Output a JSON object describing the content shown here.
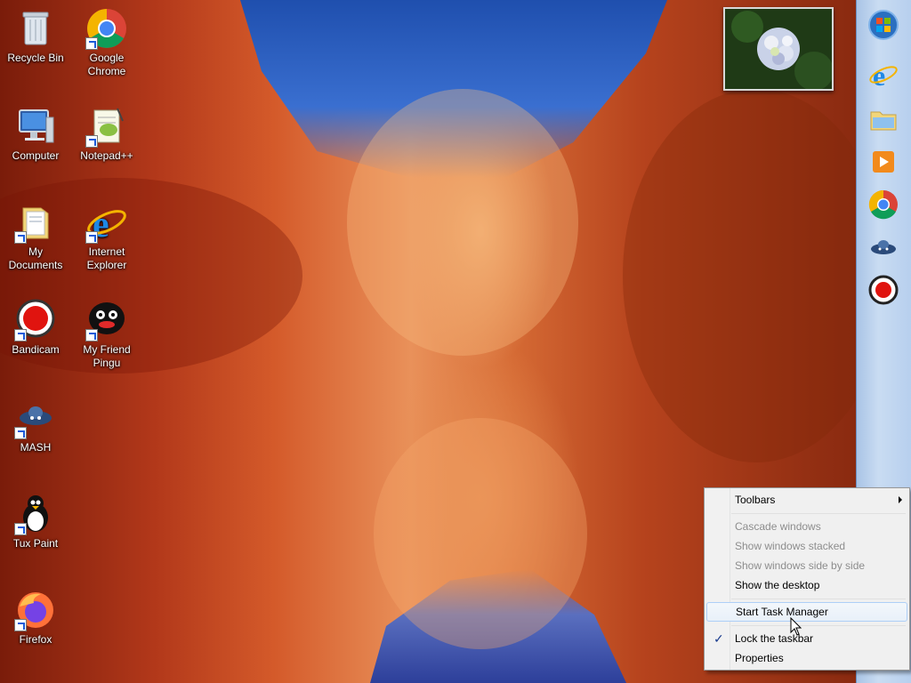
{
  "desktop": {
    "icons": [
      {
        "label": "Recycle Bin",
        "icon": "recycle-bin-icon"
      },
      {
        "label": "Google\nChrome",
        "icon": "chrome-icon"
      },
      {
        "label": "Computer",
        "icon": "computer-icon"
      },
      {
        "label": "Notepad++",
        "icon": "notepad-plus-plus-icon"
      },
      {
        "label": "My\nDocuments",
        "icon": "documents-folder-icon"
      },
      {
        "label": "Internet\nExplorer",
        "icon": "internet-explorer-icon"
      },
      {
        "label": "Bandicam",
        "icon": "bandicam-icon"
      },
      {
        "label": "My Friend\nPingu",
        "icon": "pingu-icon"
      },
      {
        "label": "MASH",
        "icon": "mash-icon"
      },
      {
        "label": "Tux Paint",
        "icon": "tux-paint-icon"
      },
      {
        "label": "Firefox",
        "icon": "firefox-icon"
      }
    ]
  },
  "taskbar": {
    "buttons": [
      {
        "icon": "start-orb-icon"
      },
      {
        "icon": "internet-explorer-icon"
      },
      {
        "icon": "file-explorer-icon"
      },
      {
        "icon": "media-player-icon"
      },
      {
        "icon": "chrome-icon"
      },
      {
        "icon": "mash-icon"
      },
      {
        "icon": "bandicam-icon"
      }
    ]
  },
  "context_menu": {
    "toolbars": "Toolbars",
    "cascade": "Cascade windows",
    "stacked": "Show windows stacked",
    "side_by_side": "Show windows side by side",
    "show_desktop": "Show the desktop",
    "task_manager": "Start Task Manager",
    "lock_taskbar": "Lock the taskbar",
    "properties": "Properties",
    "lock_checked": true
  },
  "colors": {
    "taskbar": "#b7cfee",
    "menu_bg": "#f0f0f0",
    "menu_hover_border": "#aecff7",
    "disabled_text": "#8d8d8d"
  }
}
